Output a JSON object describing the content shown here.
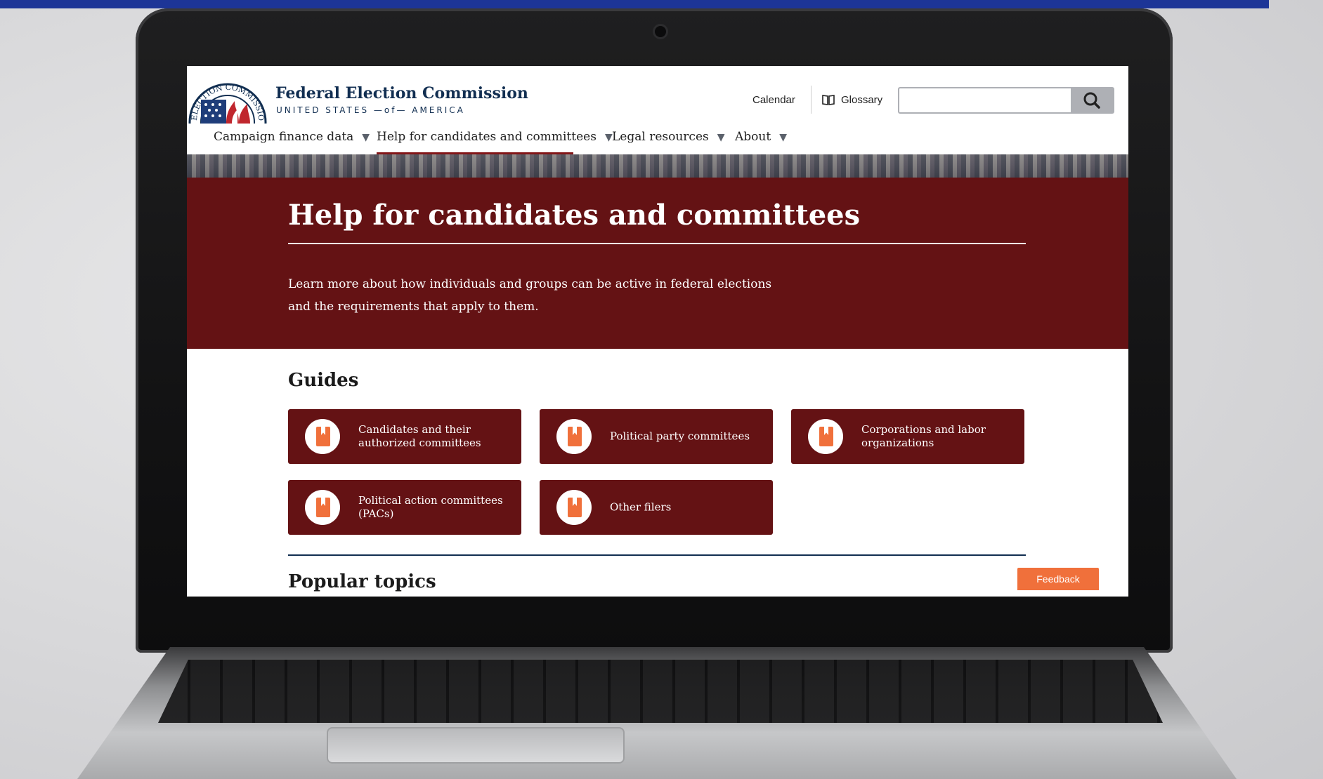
{
  "brand": {
    "name": "Federal Election Commission",
    "subtitle": "UNITED STATES —of— AMERICA",
    "seal_text": "ELECTION COMMISSION"
  },
  "utility": {
    "calendar_label": "Calendar",
    "glossary_label": "Glossary",
    "search_placeholder": ""
  },
  "nav": {
    "items": [
      {
        "label": "Campaign finance data"
      },
      {
        "label": "Help for candidates and committees",
        "active": true
      },
      {
        "label": "Legal resources"
      },
      {
        "label": "About"
      }
    ]
  },
  "hero": {
    "title": "Help for candidates and committees",
    "description": "Learn more about how individuals and groups can be active in federal elections and the requirements that apply to them."
  },
  "guides": {
    "title": "Guides",
    "cards": [
      {
        "label": "Candidates and their authorized committees",
        "icon": "book-icon"
      },
      {
        "label": "Political party committees",
        "icon": "book-icon"
      },
      {
        "label": "Corporations and labor organizations",
        "icon": "book-icon"
      },
      {
        "label": "Political action committees (PACs)",
        "icon": "book-icon"
      },
      {
        "label": "Other filers",
        "icon": "book-icon"
      }
    ]
  },
  "popular": {
    "title": "Popular topics"
  },
  "feedback": {
    "label": "Feedback"
  },
  "colors": {
    "hero_background": "#641214",
    "accent": "#f0703b",
    "brand_navy": "#112e51",
    "top_bar": "#1d3597"
  }
}
